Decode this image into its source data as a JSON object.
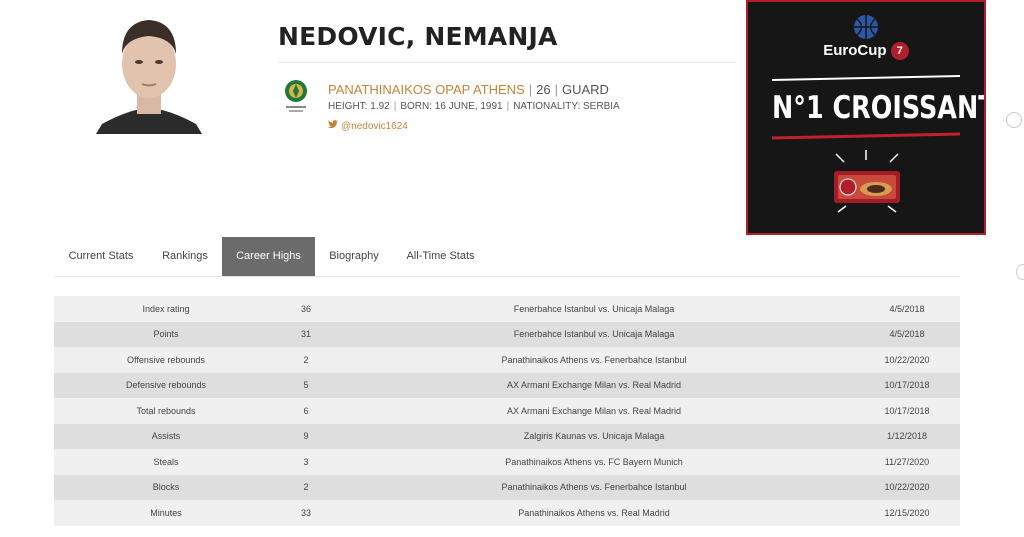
{
  "player": {
    "name": "NEDOVIC, NEMANJA",
    "club": "PANATHINAIKOS OPAP ATHENS",
    "number": "26",
    "position": "GUARD",
    "height": "HEIGHT: 1.92",
    "born": "BORN: 16 JUNE, 1991",
    "nationality": "NATIONALITY: SERBIA",
    "twitter": "@nedovic1624"
  },
  "ad": {
    "brand": "EuroCup",
    "headline": "N°1 CROISSANT",
    "brand_color": "#b21e2a"
  },
  "tabs": [
    {
      "label": "Current Stats",
      "active": false
    },
    {
      "label": "Rankings",
      "active": false
    },
    {
      "label": "Career Highs",
      "active": true
    },
    {
      "label": "Biography",
      "active": false
    },
    {
      "label": "All-Time Stats",
      "active": false
    }
  ],
  "career_highs": [
    {
      "stat": "Index rating",
      "value": "36",
      "game": "Fenerbahce Istanbul vs. Unicaja Malaga",
      "date": "4/5/2018"
    },
    {
      "stat": "Points",
      "value": "31",
      "game": "Fenerbahce Istanbul vs. Unicaja Malaga",
      "date": "4/5/2018"
    },
    {
      "stat": "Offensive rebounds",
      "value": "2",
      "game": "Panathinaikos Athens vs. Fenerbahce Istanbul",
      "date": "10/22/2020"
    },
    {
      "stat": "Defensive rebounds",
      "value": "5",
      "game": "AX Armani Exchange Milan vs. Real Madrid",
      "date": "10/17/2018"
    },
    {
      "stat": "Total rebounds",
      "value": "6",
      "game": "AX Armani Exchange Milan vs. Real Madrid",
      "date": "10/17/2018"
    },
    {
      "stat": "Assists",
      "value": "9",
      "game": "Zalgiris Kaunas vs. Unicaja Malaga",
      "date": "1/12/2018"
    },
    {
      "stat": "Steals",
      "value": "3",
      "game": "Panathinaikos Athens vs. FC Bayern Munich",
      "date": "11/27/2020"
    },
    {
      "stat": "Blocks",
      "value": "2",
      "game": "Panathinaikos Athens vs. Fenerbahce Istanbul",
      "date": "10/22/2020"
    },
    {
      "stat": "Minutes",
      "value": "33",
      "game": "Panathinaikos Athens vs. Real Madrid",
      "date": "12/15/2020"
    }
  ]
}
